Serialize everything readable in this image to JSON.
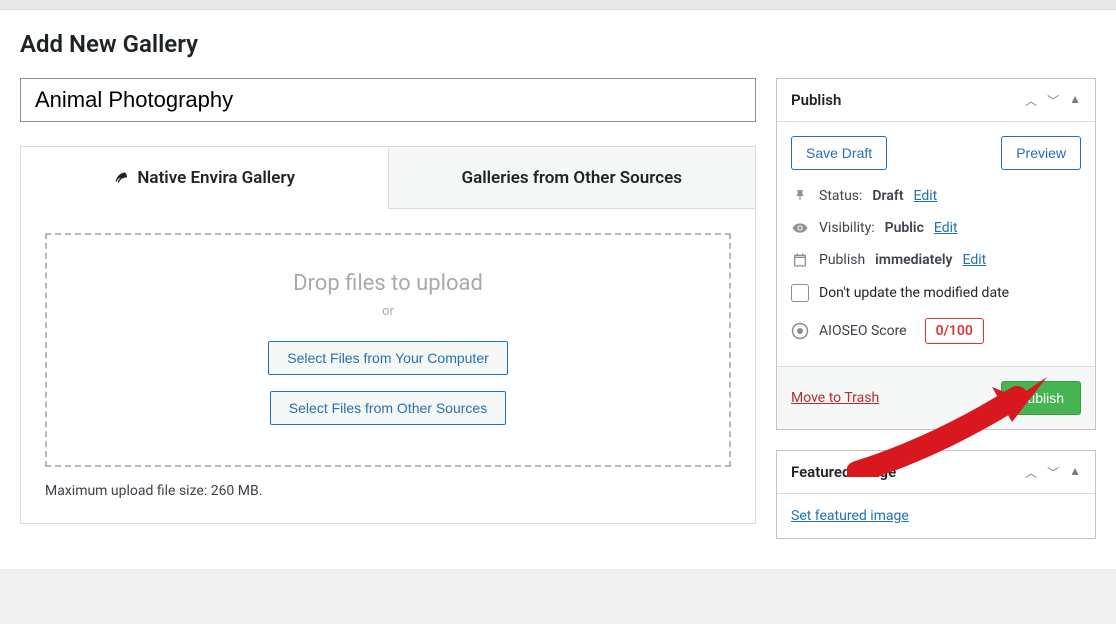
{
  "page": {
    "title": "Add New Gallery"
  },
  "title_input": {
    "value": "Animal Photography"
  },
  "tabs": {
    "native": "Native Envira Gallery",
    "other": "Galleries from Other Sources"
  },
  "dropzone": {
    "heading": "Drop files to upload",
    "or": "or",
    "select_computer": "Select Files from Your Computer",
    "select_other": "Select Files from Other Sources"
  },
  "upload_note": "Maximum upload file size: 260 MB.",
  "publish": {
    "title": "Publish",
    "save_draft": "Save Draft",
    "preview": "Preview",
    "status_label": "Status:",
    "status_value": "Draft",
    "visibility_label": "Visibility:",
    "visibility_value": "Public",
    "publish_label": "Publish",
    "publish_value": "immediately",
    "edit": "Edit",
    "dont_update": "Don't update the modified date",
    "aioseo_label": "AIOSEO Score",
    "aioseo_value": "0/100",
    "trash": "Move to Trash",
    "publish_btn": "Publish"
  },
  "featured": {
    "title": "Featured Image",
    "link": "Set featured image"
  }
}
